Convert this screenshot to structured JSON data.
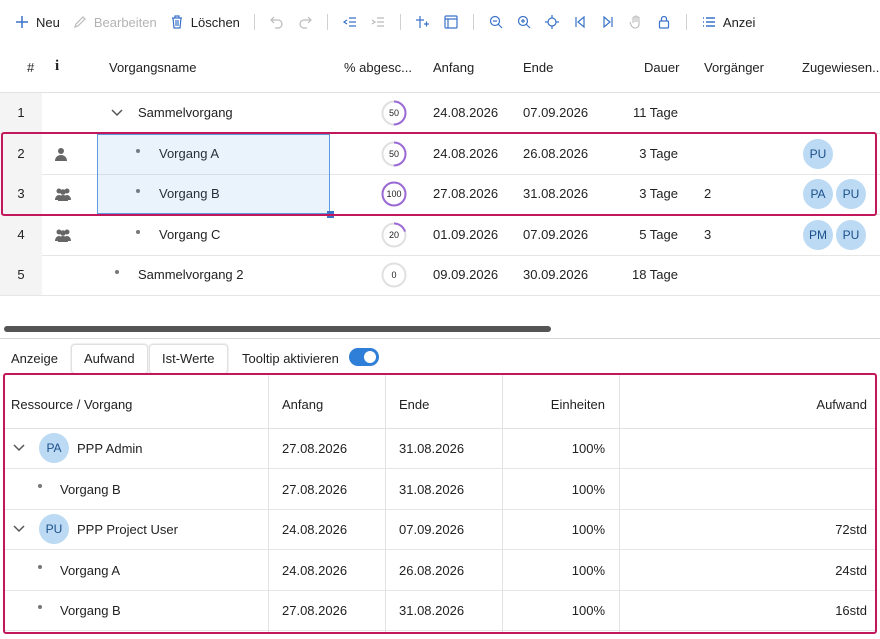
{
  "toolbar": {
    "new_label": "Neu",
    "edit_label": "Bearbeiten",
    "delete_label": "Löschen",
    "view_label": "Anzei"
  },
  "grid": {
    "headers": {
      "num": "#",
      "info": "i",
      "name": "Vorgangsname",
      "pct": "% abgesc...",
      "start": "Anfang",
      "end": "Ende",
      "duration": "Dauer",
      "pred": "Vorgänger",
      "assigned": "Zugewiesen..."
    },
    "rows": [
      {
        "num": "1",
        "name": "Sammelvorgang",
        "pct": "50",
        "progress": 0.5,
        "start": "24.08.2026",
        "end": "07.09.2026",
        "duration": "11 Tage",
        "pred": ""
      },
      {
        "num": "2",
        "name": "Vorgang A",
        "pct": "50",
        "progress": 0.5,
        "start": "24.08.2026",
        "end": "26.08.2026",
        "duration": "3 Tage",
        "pred": "",
        "avatars": [
          "PU"
        ]
      },
      {
        "num": "3",
        "name": "Vorgang B",
        "pct": "100",
        "progress": 1.0,
        "start": "27.08.2026",
        "end": "31.08.2026",
        "duration": "3 Tage",
        "pred": "2",
        "avatars": [
          "PA",
          "PU"
        ]
      },
      {
        "num": "4",
        "name": "Vorgang C",
        "pct": "20",
        "progress": 0.2,
        "start": "01.09.2026",
        "end": "07.09.2026",
        "duration": "5 Tage",
        "pred": "3",
        "avatars": [
          "PM",
          "PU"
        ]
      },
      {
        "num": "5",
        "name": "Sammelvorgang 2",
        "pct": "0",
        "progress": 0.0,
        "start": "09.09.2026",
        "end": "30.09.2026",
        "duration": "18 Tage",
        "pred": ""
      }
    ]
  },
  "lower": {
    "display_label": "Anzeige",
    "tab_effort": "Aufwand",
    "tab_actual": "Ist-Werte",
    "tooltip_label": "Tooltip aktivieren",
    "tooltip_enabled": true
  },
  "resource_table": {
    "headers": {
      "resource": "Ressource / Vorgang",
      "start": "Anfang",
      "end": "Ende",
      "units": "Einheiten",
      "effort": "Aufwand"
    },
    "rows": [
      {
        "avatar": "PA",
        "name": "PPP Admin",
        "start": "27.08.2026",
        "end": "31.08.2026",
        "units": "100%",
        "effort": ""
      },
      {
        "name": "Vorgang B",
        "start": "27.08.2026",
        "end": "31.08.2026",
        "units": "100%",
        "effort": ""
      },
      {
        "avatar": "PU",
        "name": "PPP Project User",
        "start": "24.08.2026",
        "end": "07.09.2026",
        "units": "100%",
        "effort": "72std"
      },
      {
        "name": "Vorgang A",
        "start": "24.08.2026",
        "end": "26.08.2026",
        "units": "100%",
        "effort": "24std"
      },
      {
        "name": "Vorgang B",
        "start": "27.08.2026",
        "end": "31.08.2026",
        "units": "100%",
        "effort": "16std"
      }
    ]
  },
  "colors": {
    "accent": "#3a73c9",
    "progress": "#9b6ad6",
    "highlight_border": "#c2185b",
    "avatar_bg": "#bcdaf3"
  }
}
